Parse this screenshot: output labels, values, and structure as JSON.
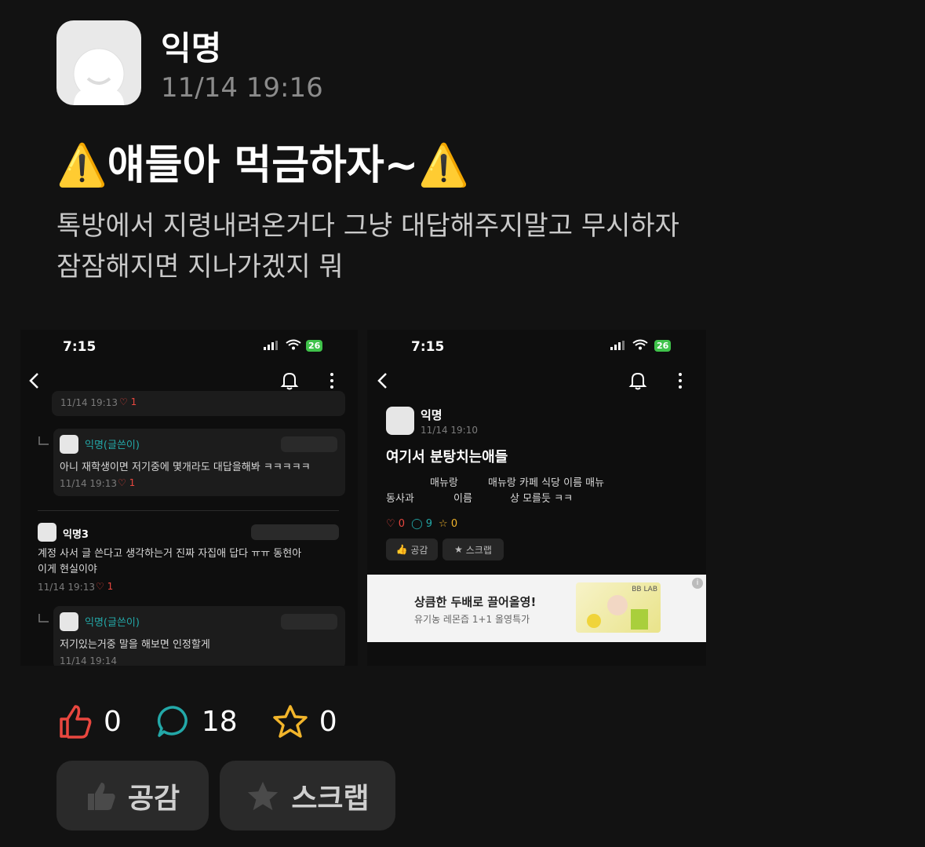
{
  "post": {
    "author": "익명",
    "datetime": "11/14 19:16",
    "title_text": "얘들아 먹금하자~",
    "warning_icon": "⚠️",
    "body_lines": [
      "톡방에서 지령내려온거다 그냥 대답해주지말고 무시하자",
      "잠잠해지면 지나가겠지 뭐"
    ]
  },
  "shot_left": {
    "status_time": "7:15",
    "battery": "26",
    "top_meta": "11/14 19:13",
    "top_like": "1",
    "reply1": {
      "name": "익명(글쓴이)",
      "text": "아니 재학생이면 저기중에 몇개라도 대답을해봐 ㅋㅋㅋㅋㅋ",
      "time": "11/14 19:13",
      "likes": "1"
    },
    "comment3": {
      "name": "익명3",
      "text_line1": "계정 사서 글 쓴다고 생각하는거 진짜 자집애 답다 ㅠㅠ 동현아",
      "text_line2": "이게 현실이야",
      "time": "11/14 19:13",
      "likes": "1"
    },
    "reply2": {
      "name": "익명(글쓴이)",
      "text": "저기있는거중 말을 해보면 인정할게",
      "time": "11/14 19:14"
    }
  },
  "shot_right": {
    "status_time": "7:15",
    "battery": "26",
    "author": "익명",
    "datetime": "11/14 19:10",
    "title": "여기서 분탕치는애들",
    "line1_a": "매뉴랑",
    "line1_b": "매뉴랑 카페 식당 이름 매뉴",
    "line2_a": "동사과",
    "line2_b": "이름",
    "line2_c": "상 모를듯 ㅋㅋ",
    "likes": "0",
    "comments": "9",
    "scraps": "0",
    "like_btn": "공감",
    "scrap_btn": "스크랩",
    "ad": {
      "headline": "상큼한 두배로 끌어올영!",
      "sub": "유기농 레몬즙 1+1 올영특가",
      "brand": "BB LAB"
    }
  },
  "stats": {
    "likes": "0",
    "comments": "18",
    "scraps": "0",
    "like_color": "#e9473f",
    "comment_color": "#23a8a8",
    "scrap_color": "#f2b52b"
  },
  "buttons": {
    "like": "공감",
    "scrap": "스크랩"
  }
}
